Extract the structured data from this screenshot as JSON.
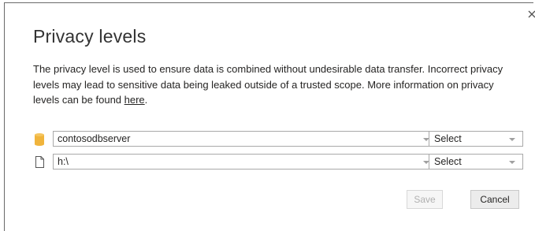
{
  "dialog": {
    "title": "Privacy levels",
    "close_icon": "close-icon",
    "description_pre": "The privacy level is used to ensure data is combined without undesirable data transfer. Incorrect privacy levels may lead to sensitive data being leaked outside of a trusted scope. More information on privacy levels can be found ",
    "description_link": "here",
    "description_post": "."
  },
  "sources": [
    {
      "icon": "database-icon",
      "name": "contosodbserver",
      "level": "Select"
    },
    {
      "icon": "file-icon",
      "name": "h:\\",
      "level": "Select"
    }
  ],
  "buttons": {
    "save": "Save",
    "cancel": "Cancel"
  },
  "colors": {
    "database_icon": "#f0b43c",
    "border": "#a9a9a9",
    "disabled_text": "#b0b0b0"
  }
}
